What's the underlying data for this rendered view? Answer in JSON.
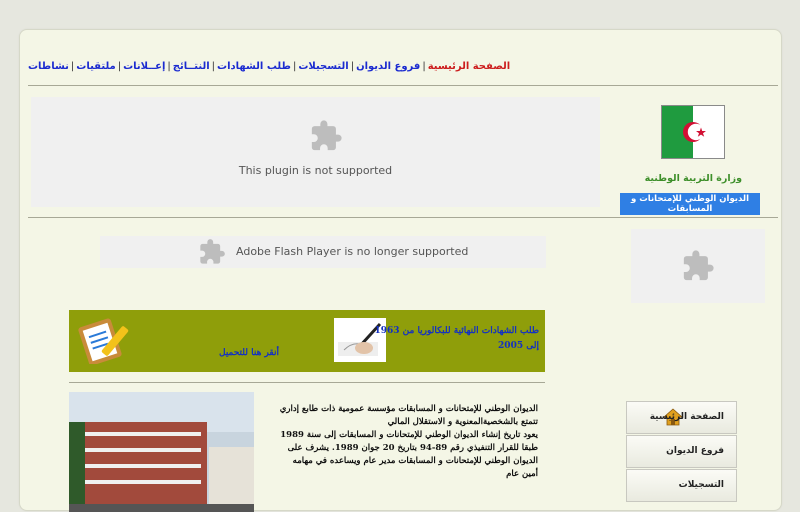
{
  "topnav": [
    {
      "label": "الصفحة الرئيسية",
      "active": true
    },
    {
      "label": "فروع الديوان"
    },
    {
      "label": "التسجيلات"
    },
    {
      "label": "طلب الشهادات"
    },
    {
      "label": "النتــائج"
    },
    {
      "label": "إعــلانات"
    },
    {
      "label": "ملتقيات"
    },
    {
      "label": "نشاطات"
    }
  ],
  "plugin_main": {
    "message": "This plugin is not supported"
  },
  "plugin_flash": {
    "message": "Adobe Flash Player is no longer supported"
  },
  "header": {
    "ministry": "وزارة التربية الوطنية",
    "office": "الديوان الوطني للإمتحانات و المسابقات"
  },
  "banner": {
    "title": "طلب الشهادات النهائية للبكالوريا من 1963 إلى 2005",
    "link": "أنقر هنا للتحميل"
  },
  "article": {
    "lines": [
      "الديوان الوطني للإمتحانات و المسابقات مؤسسة عمومية ذات طابع إداري",
      "تتمتع بالشخصيةالمعنوية و الاستقلال المالي",
      "يعود تاريخ إنشاء الديوان الوطني للإمتحانات و المسابقات إلى سنة 1989",
      "طبقا للقرار التنفيذي رقم 89-94 بتاريخ 20 جوان 1989. يشرف على",
      "الديوان الوطني للإمتحانات و المسابقات مدير عام ويساعده في مهامه",
      "أمين عام"
    ]
  },
  "side_menu": [
    {
      "label": "الصفحة الرئيسية",
      "icon": "home-icon"
    },
    {
      "label": "فروع الديوان"
    },
    {
      "label": "التسجيلات"
    }
  ],
  "colors": {
    "nav_link": "#1b2bd0",
    "nav_active": "#cc1d1d",
    "banner_bg": "#8f9e0a",
    "highlight": "#2f7fe4"
  }
}
